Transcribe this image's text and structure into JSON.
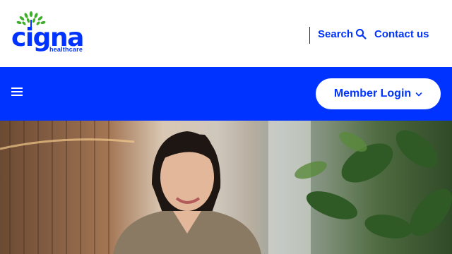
{
  "brand": {
    "name": "cigna",
    "sub": "healthcare",
    "logo_icon": "tree-of-life-icon",
    "color": "#0033ff"
  },
  "header": {
    "search_label": "Search",
    "search_icon": "search-icon",
    "contact_label": "Contact us"
  },
  "nav": {
    "menu_icon": "hamburger-menu-icon",
    "login_label": "Member Login",
    "login_icon": "chevron-down-icon",
    "bar_color": "#0033ff"
  },
  "hero": {
    "image": "photo-woman-smiling-office"
  }
}
